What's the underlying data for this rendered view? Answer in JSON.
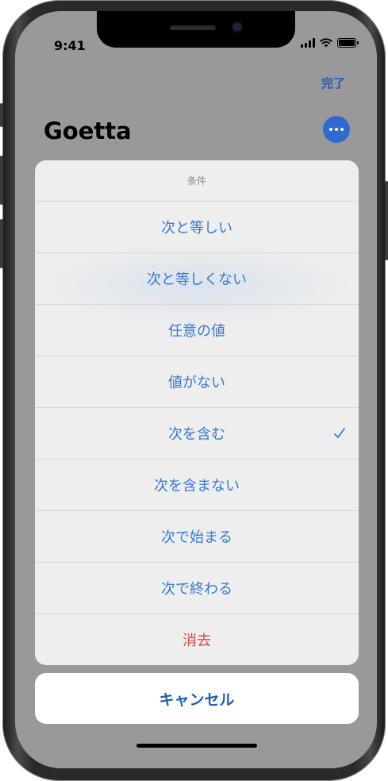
{
  "status": {
    "time": "9:41"
  },
  "nav": {
    "done_label": "完了",
    "title": "Goetta",
    "more_icon": "ellipsis-circle-icon"
  },
  "sheet": {
    "header": "条件",
    "options": [
      {
        "label": "次と等しい",
        "selected": false
      },
      {
        "label": "次と等しくない",
        "selected": false
      },
      {
        "label": "任意の値",
        "selected": false
      },
      {
        "label": "値がない",
        "selected": false
      },
      {
        "label": "次を含む",
        "selected": true
      },
      {
        "label": "次を含まない",
        "selected": false
      },
      {
        "label": "次で始まる",
        "selected": false
      },
      {
        "label": "次で終わる",
        "selected": false
      }
    ],
    "clear_label": "消去",
    "cancel_label": "キャンセル"
  },
  "colors": {
    "accent": "#3478d8",
    "destructive": "#e0453a",
    "more_button": "#2f6ad0"
  }
}
